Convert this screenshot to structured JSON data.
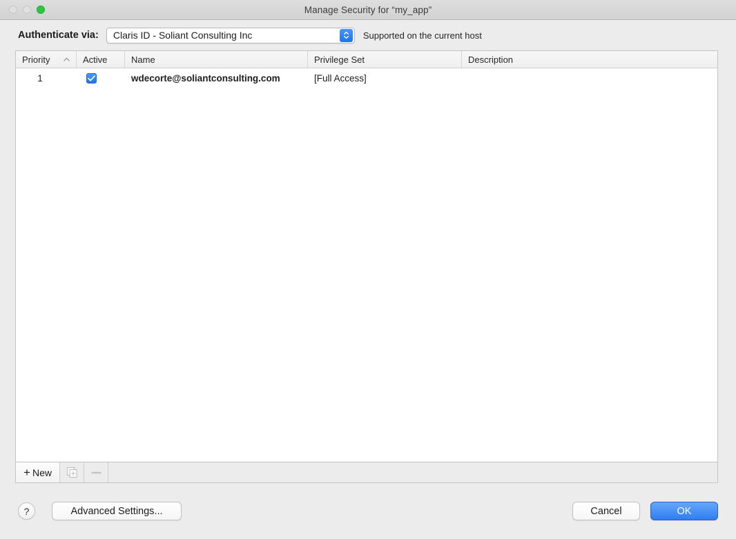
{
  "window": {
    "title": "Manage Security for “my_app”",
    "traffic_lights": [
      {
        "name": "close",
        "state": "disabled"
      },
      {
        "name": "minimize",
        "state": "disabled"
      },
      {
        "name": "zoom",
        "state": "active",
        "color": "#28c940"
      }
    ]
  },
  "auth": {
    "label": "Authenticate via:",
    "selected": "Claris ID - Soliant Consulting Inc",
    "note": "Supported on the current host"
  },
  "table": {
    "columns": [
      {
        "key": "priority",
        "label": "Priority",
        "sort": "ascending"
      },
      {
        "key": "active",
        "label": "Active"
      },
      {
        "key": "name",
        "label": "Name"
      },
      {
        "key": "privilege_set",
        "label": "Privilege Set"
      },
      {
        "key": "description",
        "label": "Description"
      }
    ],
    "rows": [
      {
        "priority": "1",
        "active": true,
        "name": "wdecorte@soliantconsulting.com",
        "privilege_set": "[Full Access]",
        "description": ""
      }
    ]
  },
  "table_toolbar": {
    "new_plus": "+",
    "new_label": "New",
    "duplicate_icon": "duplicate-icon",
    "remove_icon": "minus-icon"
  },
  "footer": {
    "help_label": "?",
    "advanced_settings_label": "Advanced Settings...",
    "cancel_label": "Cancel",
    "ok_label": "OK"
  },
  "colors": {
    "accent_blue": "#2e7df0",
    "checkbox_blue": "#2273ea",
    "window_bg": "#ececec",
    "titlebar_bg": "#d6d6d6",
    "green_light": "#28c940"
  }
}
